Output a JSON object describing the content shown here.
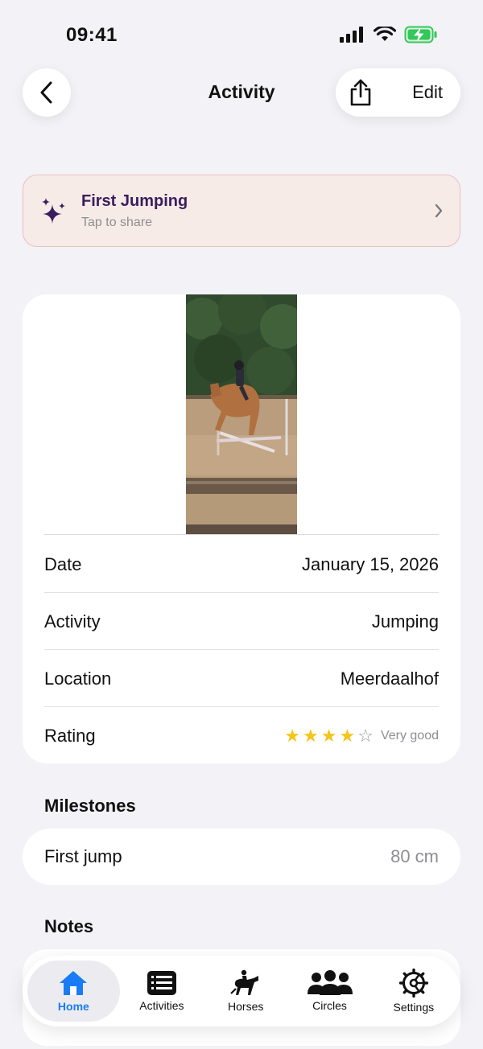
{
  "status_bar": {
    "time": "09:41"
  },
  "nav": {
    "title": "Activity",
    "edit_label": "Edit",
    "back_icon": "chevron-left-icon",
    "share_icon": "share-icon"
  },
  "share_banner": {
    "title": "First Jumping",
    "subtitle": "Tap to share",
    "icon": "sparkles-icon"
  },
  "details": {
    "rows": [
      {
        "label": "Date",
        "value": "January 15, 2026"
      },
      {
        "label": "Activity",
        "value": "Jumping"
      },
      {
        "label": "Location",
        "value": "Meerdaalhof"
      }
    ],
    "rating": {
      "label": "Rating",
      "stars": 4,
      "max_stars": 5,
      "text": "Very good"
    }
  },
  "milestones": {
    "heading": "Milestones",
    "items": [
      {
        "label": "First jump",
        "value": "80 cm"
      }
    ]
  },
  "notes": {
    "heading": "Notes"
  },
  "tab_bar": {
    "tabs": [
      {
        "label": "Home",
        "icon": "house-icon",
        "active": true
      },
      {
        "label": "Activities",
        "icon": "list-icon",
        "active": false
      },
      {
        "label": "Horses",
        "icon": "horse-rider-icon",
        "active": false
      },
      {
        "label": "Circles",
        "icon": "people-icon",
        "active": false
      },
      {
        "label": "Settings",
        "icon": "gear-icon",
        "active": false
      }
    ]
  },
  "colors": {
    "accent": "#1a7cf5",
    "star": "#f5c518",
    "banner_bg": "#f6ebe6",
    "banner_border": "#ecbfc3",
    "banner_title": "#3a1d5e",
    "background": "#f2f2f7"
  }
}
